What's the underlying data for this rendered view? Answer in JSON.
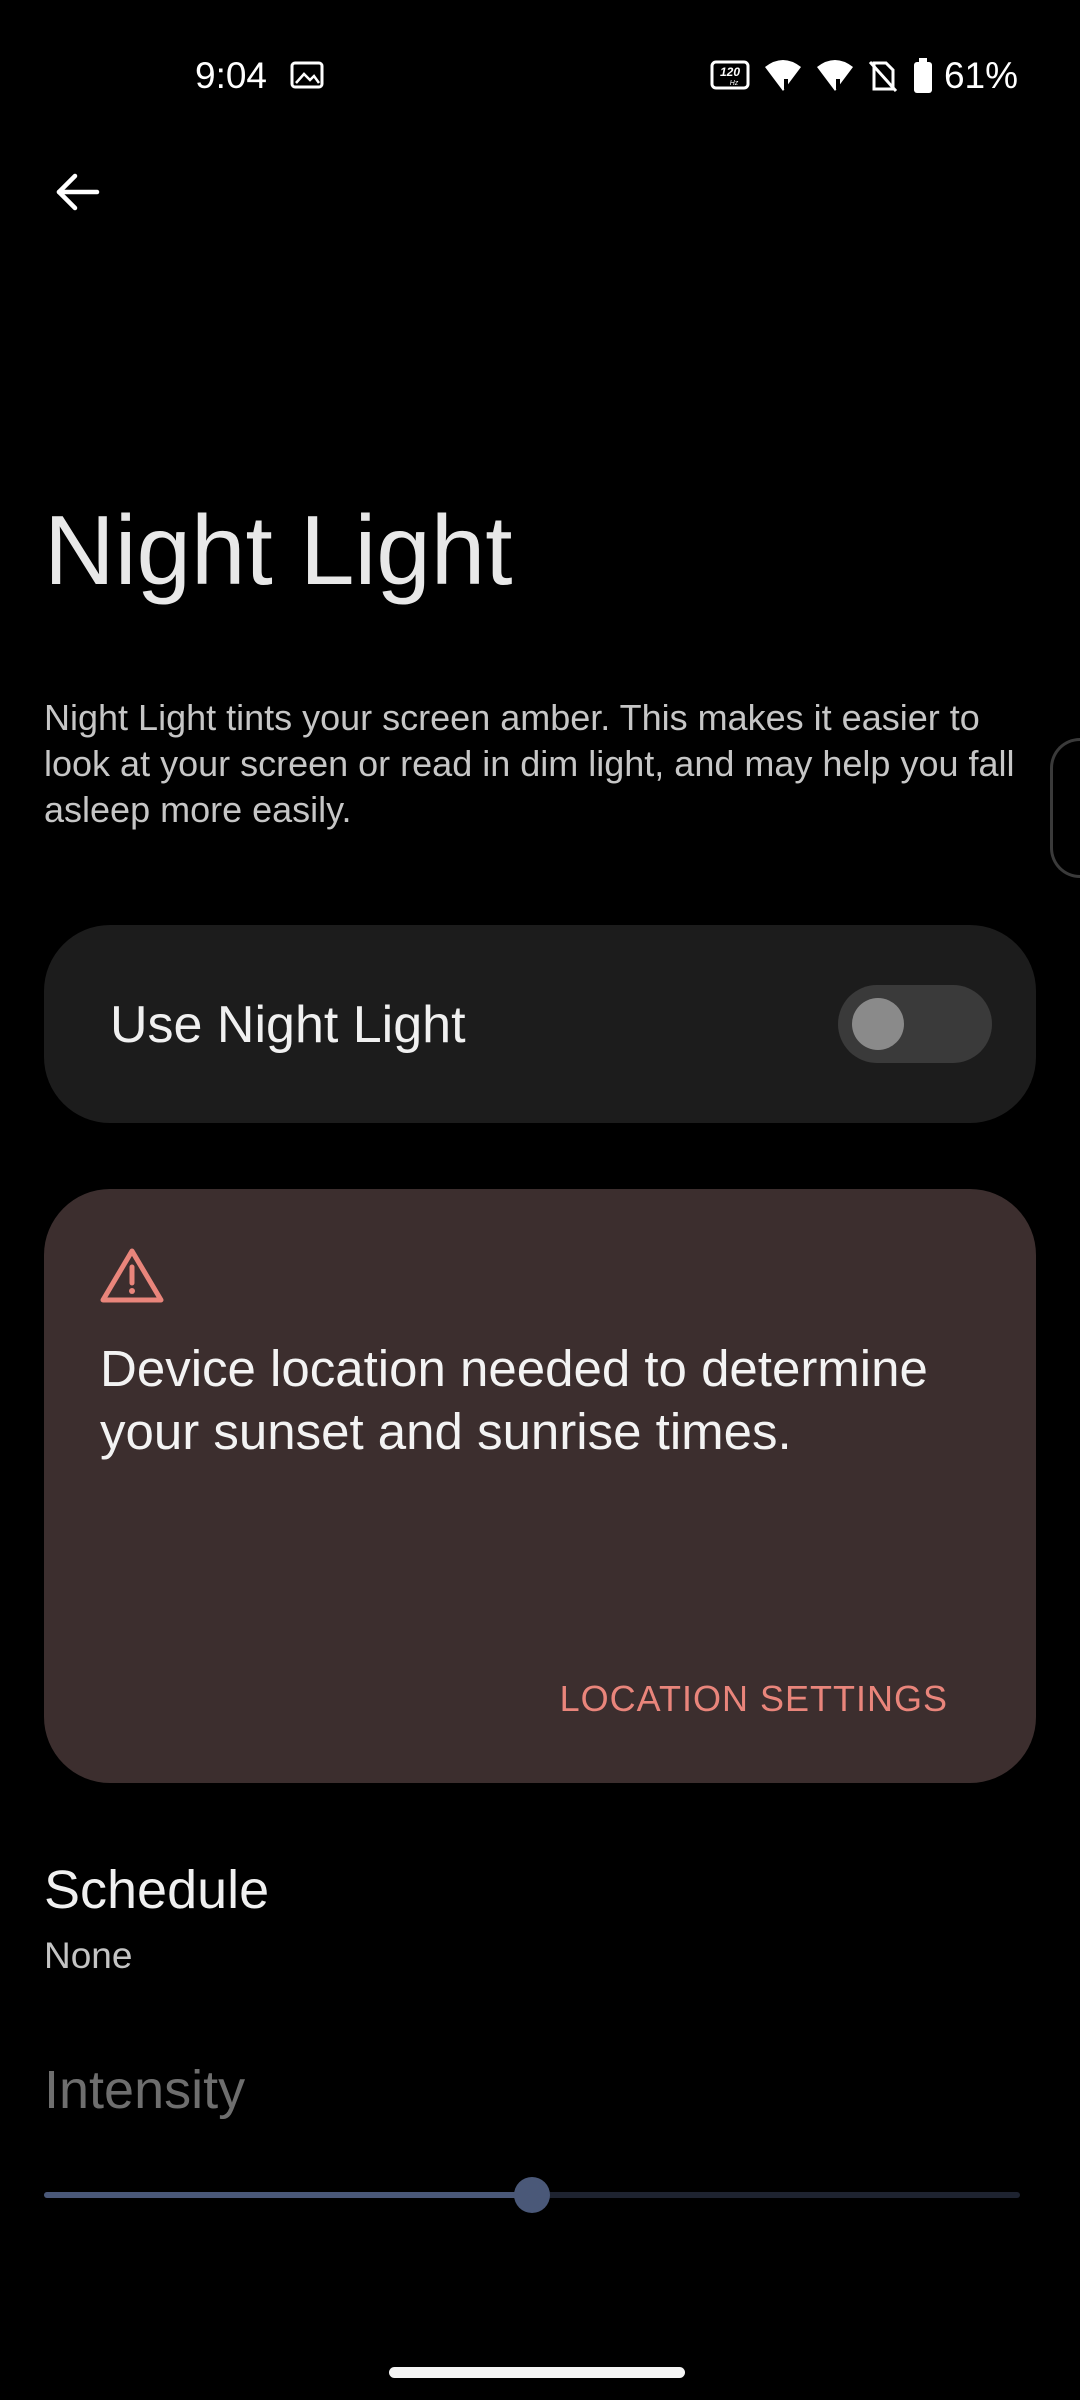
{
  "status_bar": {
    "time": "9:04",
    "refresh_rate_icon_text": "120",
    "refresh_rate_icon_sub": "Hz",
    "battery_percent": "61%",
    "icons": [
      "gallery-icon",
      "refresh-rate-120hz-icon",
      "wifi-icon",
      "signal-icon",
      "no-sim-icon",
      "battery-icon"
    ]
  },
  "page": {
    "title": "Night Light",
    "description": "Night Light tints your screen amber. This makes it easier to look at your screen or read in dim light, and may help you fall asleep more easily."
  },
  "toggle": {
    "label": "Use Night Light",
    "enabled": false
  },
  "warning": {
    "icon": "warning-icon",
    "message": "Device location needed to determine your sunset and sunrise times.",
    "action_label": "LOCATION SETTINGS",
    "accent_color": "#e9857b"
  },
  "schedule": {
    "title": "Schedule",
    "value": "None"
  },
  "intensity": {
    "title": "Intensity",
    "level": 0.5,
    "enabled": false
  },
  "colors": {
    "background": "#000000",
    "card": "#1c1c1c",
    "warning_card": "#3c2e2e",
    "slider": "#4a5878"
  }
}
